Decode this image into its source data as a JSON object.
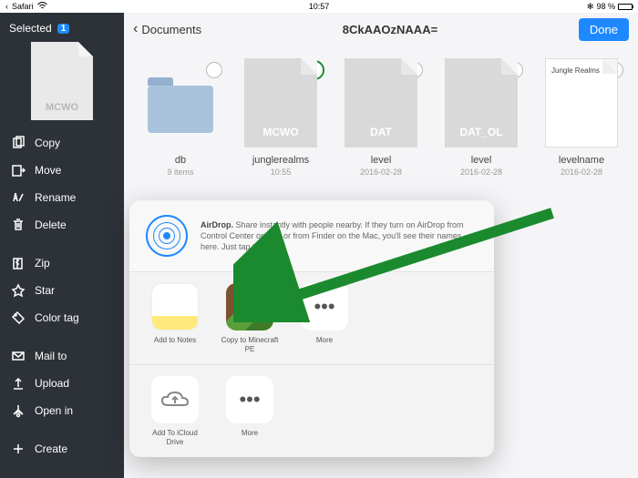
{
  "status": {
    "app": "Safari",
    "time": "10:57",
    "bt": "✻",
    "battery": "98 %"
  },
  "sidebar": {
    "selected_label": "Selected",
    "selected_count": "1",
    "thumb_label": "MCWO",
    "items": [
      {
        "label": "Copy",
        "icon": "copy"
      },
      {
        "label": "Move",
        "icon": "move"
      },
      {
        "label": "Rename",
        "icon": "rename"
      },
      {
        "label": "Delete",
        "icon": "delete"
      }
    ],
    "items2": [
      {
        "label": "Zip",
        "icon": "zip"
      },
      {
        "label": "Star",
        "icon": "star"
      },
      {
        "label": "Color tag",
        "icon": "tag"
      }
    ],
    "items3": [
      {
        "label": "Mail to",
        "icon": "mail"
      },
      {
        "label": "Upload",
        "icon": "upload"
      },
      {
        "label": "Open in",
        "icon": "openin"
      }
    ],
    "items4": [
      {
        "label": "Create",
        "icon": "create"
      }
    ]
  },
  "header": {
    "back": "Documents",
    "title": "8CkAAOzNAAA=",
    "done": "Done"
  },
  "files": [
    {
      "name": "db",
      "meta": "9 items",
      "type": "folder",
      "label": ""
    },
    {
      "name": "junglerealms",
      "meta": "10:55",
      "type": "file",
      "label": "MCWO",
      "selected": true
    },
    {
      "name": "level",
      "meta": "2016-02-28",
      "type": "file",
      "label": "DAT"
    },
    {
      "name": "level",
      "meta": "2016-02-28",
      "type": "file",
      "label": "DAT_OL"
    },
    {
      "name": "levelname",
      "meta": "2016-02-28",
      "type": "txt",
      "label": "Jungle Realms"
    }
  ],
  "share": {
    "airdrop_title": "AirDrop.",
    "airdrop_body": " Share instantly with people nearby. If they turn on AirDrop from Control Center on iOS or from Finder on the Mac, you'll see their names here. Just tap to share.",
    "row1": [
      {
        "label": "Add to Notes",
        "icon": "notes"
      },
      {
        "label": "Copy to Minecraft PE",
        "icon": "minecraft"
      },
      {
        "label": "More",
        "icon": "more"
      }
    ],
    "row2": [
      {
        "label": "Add To iCloud Drive",
        "icon": "icloud"
      },
      {
        "label": "More",
        "icon": "more"
      }
    ]
  }
}
